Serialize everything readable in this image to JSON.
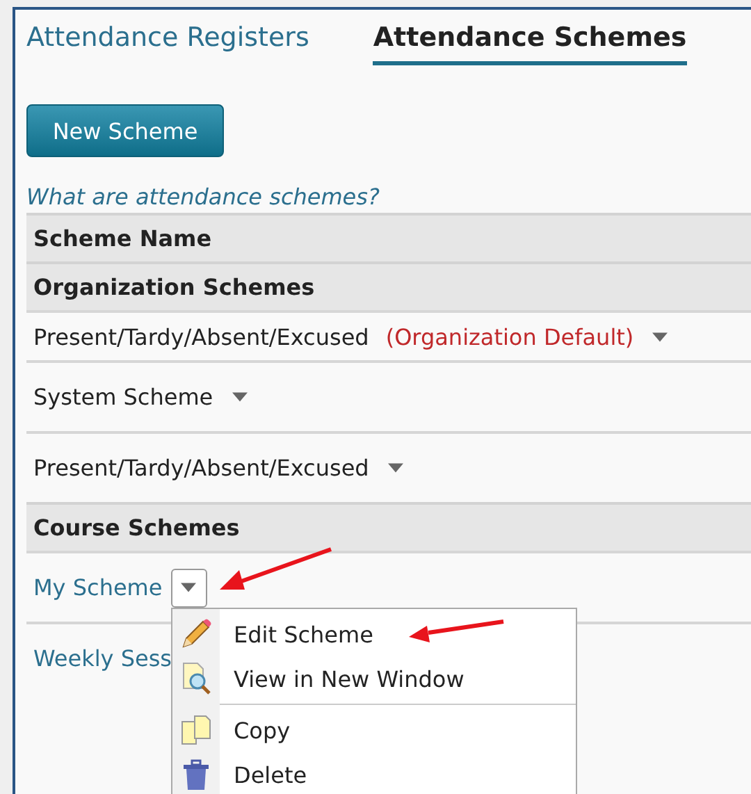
{
  "tabs": [
    {
      "label": "Attendance Registers",
      "selected": false
    },
    {
      "label": "Attendance Schemes",
      "selected": true
    }
  ],
  "new_button": "New Scheme",
  "help_link": "What are attendance schemes?",
  "table": {
    "column": "Scheme Name",
    "groups": [
      {
        "title": "Organization Schemes",
        "rows": [
          {
            "name": "Present/Tardy/Absent/Excused",
            "badge": "(Organization Default)",
            "link": false,
            "menu_open": false
          },
          {
            "name": "System Scheme",
            "link": false,
            "menu_open": false
          },
          {
            "name": "Present/Tardy/Absent/Excused",
            "link": false,
            "menu_open": false
          }
        ]
      },
      {
        "title": "Course Schemes",
        "rows": [
          {
            "name": "My Scheme",
            "link": true,
            "menu_open": true
          },
          {
            "name": "Weekly Sess",
            "link": true
          }
        ]
      }
    ]
  },
  "context_menu": {
    "items": [
      {
        "kind": "item",
        "label": "Edit Scheme"
      },
      {
        "kind": "item",
        "label": "View in New Window"
      },
      {
        "kind": "separator"
      },
      {
        "kind": "item",
        "label": "Copy"
      },
      {
        "kind": "item",
        "label": "Delete"
      }
    ]
  }
}
